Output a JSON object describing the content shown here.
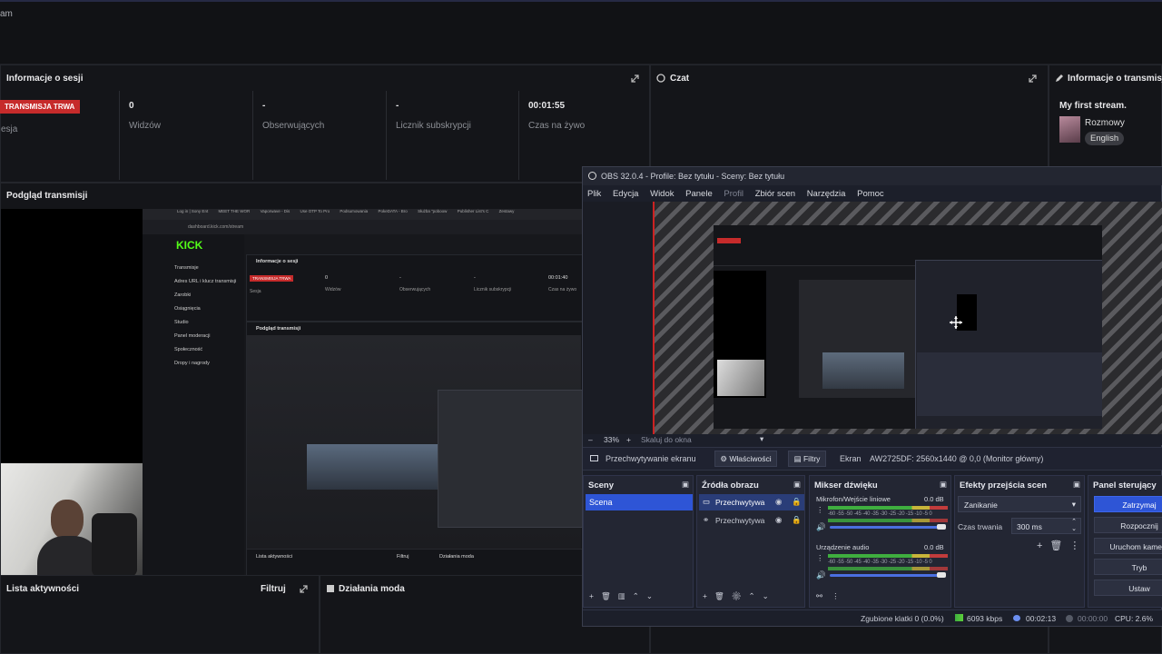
{
  "top": {
    "cut_text": "am"
  },
  "session": {
    "title": "Informacje o sesji",
    "status_badge": "TRANSMISJA TRWA",
    "status_sub": "esja",
    "stats": [
      {
        "value": "0",
        "label": "Widzów"
      },
      {
        "value": "-",
        "label": "Obserwujących"
      },
      {
        "value": "-",
        "label": "Licznik subskrypcji"
      },
      {
        "value": "00:01:55",
        "label": "Czas na żywo"
      }
    ]
  },
  "chat": {
    "title": "Czat"
  },
  "stream_info": {
    "title": "Informacje o transmisji",
    "stream_title": "My first stream.",
    "category": "Rozmowy",
    "language": "English"
  },
  "preview": {
    "title": "Podgląd transmisji",
    "bookmarks": [
      "Log in | Sony Ent",
      "MEET THE WOR",
      "Vaporwave - Dis",
      "Use OTP To Pro",
      "Podsumowania",
      "PokeDATA - Bro",
      "Służba \"poboow",
      "Publisher List's C",
      "Zestawy"
    ],
    "url": "dashboard.kick.com/stream",
    "logo": "KICK",
    "nav": [
      "Transmisje",
      "Adres URL i klucz transmisji",
      "Zarobki",
      "Osiągnięcia",
      "Studio",
      "Panel moderacji",
      "Społeczność",
      "Dropy i nagrody"
    ],
    "inner_session_title": "Informacje o sesji",
    "inner_badge": "TRANSMISJA TRWA",
    "inner_sub": "Sesja",
    "inner_stats": [
      {
        "value": "0",
        "label": "Widzów"
      },
      {
        "value": "-",
        "label": "Obserwujących"
      },
      {
        "value": "-",
        "label": "Licznik subskrypcji"
      },
      {
        "value": "00:01:40",
        "label": "Czas na żywo"
      }
    ],
    "inner_preview_title": "Podgląd transmisji",
    "inner_activity": "Lista aktywności",
    "inner_filter": "Filtruj",
    "inner_mod": "Działania moda"
  },
  "activity": {
    "title": "Lista aktywności",
    "filter": "Filtruj"
  },
  "mod": {
    "title": "Działania moda"
  },
  "obs": {
    "title": "OBS 32.0.4 - Profile: Bez tytułu - Sceny: Bez tytułu",
    "menu": [
      "Plik",
      "Edycja",
      "Widok",
      "Panele",
      "Profil",
      "Zbiór scen",
      "Narzędzia",
      "Pomoc"
    ],
    "zoom": "33%",
    "zoom_mode": "Skaluj do okna",
    "source_bar": {
      "source_name": "Przechwytywanie ekranu",
      "properties": "Właściwości",
      "filters": "Filtry",
      "screen_label": "Ekran",
      "screen_value": "AW2725DF: 2560x1440 @ 0,0 (Monitor główny)"
    },
    "scenes": {
      "title": "Sceny",
      "items": [
        "Scena"
      ]
    },
    "sources": {
      "title": "Źródła obrazu",
      "items": [
        "Przechwytywa",
        "Przechwytywa"
      ]
    },
    "mixer": {
      "title": "Mikser dźwięku",
      "scale": "-60 -55 -50 -45 -40 -35 -30 -25 -20 -15 -10 -5 0",
      "channels": [
        {
          "name": "Mikrofon/Wejście liniowe",
          "db": "0.0 dB"
        },
        {
          "name": "Urządzenie audio",
          "db": "0.0 dB"
        }
      ]
    },
    "transitions": {
      "title": "Efekty przejścia scen",
      "effect": "Zanikanie",
      "duration_label": "Czas trwania",
      "duration_value": "300 ms"
    },
    "controls": {
      "title": "Panel sterujący",
      "buttons": [
        "Zatrzymaj",
        "Rozpocznij",
        "Uruchom kamerę",
        "Tryb",
        "Ustaw"
      ]
    },
    "status": {
      "dropped": "Zgubione klatki 0 (0.0%)",
      "kbps": "6093 kbps",
      "live_time": "00:02:13",
      "rec_time": "00:00:00",
      "cpu": "CPU: 2.6%"
    }
  },
  "colors": {
    "accent_red": "#c62b2b",
    "kick_green": "#53fc18",
    "obs_blue": "#2e55d6"
  }
}
